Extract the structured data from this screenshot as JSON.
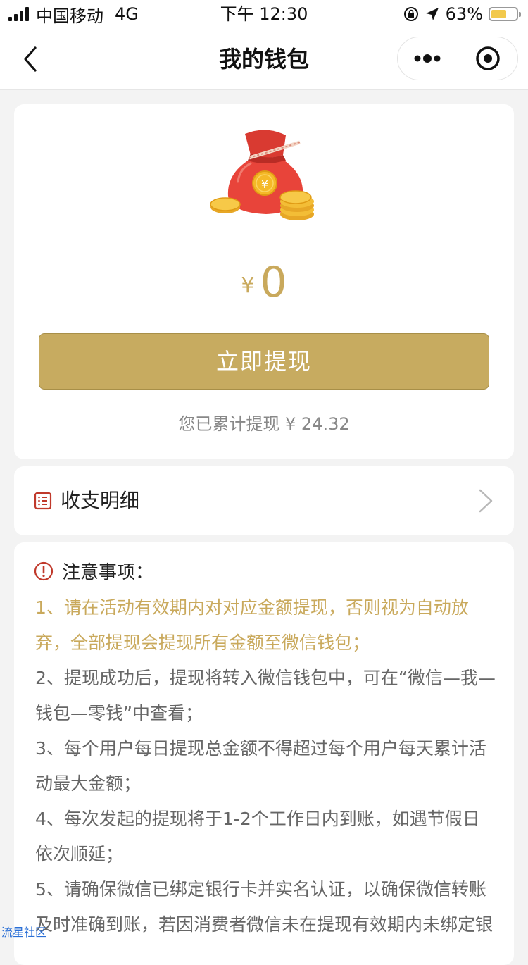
{
  "status_bar": {
    "carrier": "中国移动",
    "network": "4G",
    "time": "下午 12:30",
    "battery": "63%",
    "battery_level": 0.63
  },
  "nav": {
    "title": "我的钱包",
    "more_icon": "more-dots-icon",
    "close_icon": "target-circle-icon",
    "back_icon": "chevron-left-icon"
  },
  "wallet": {
    "currency": "¥",
    "balance": "0",
    "withdraw_label": "立即提现",
    "total_withdrawn": "您已累计提现 ¥ 24.32",
    "colors": {
      "gold": "#c7ab60",
      "bag_red": "#e8443a"
    }
  },
  "detail": {
    "label": "收支明细",
    "icon": "list-icon"
  },
  "notice": {
    "title": "注意事项：",
    "icon": "warning-circle-icon",
    "items": [
      "1、请在活动有效期内对对应金额提现，否则视为自动放弃，全部提现会提现所有金额至微信钱包；",
      "2、提现成功后，提现将转入微信钱包中，可在“微信—我—钱包—零钱”中查看；",
      "3、每个用户每日提现总金额不得超过每个用户每天累计活动最大金额；",
      "4、每次发起的提现将于1-2个工作日内到账，如遇节假日依次顺延；",
      "5、请确保微信已绑定银行卡并实名认证，以确保微信转账及时准确到账，若因消费者微信未在提现有效期内未绑定银"
    ]
  },
  "watermark": "流星社区"
}
